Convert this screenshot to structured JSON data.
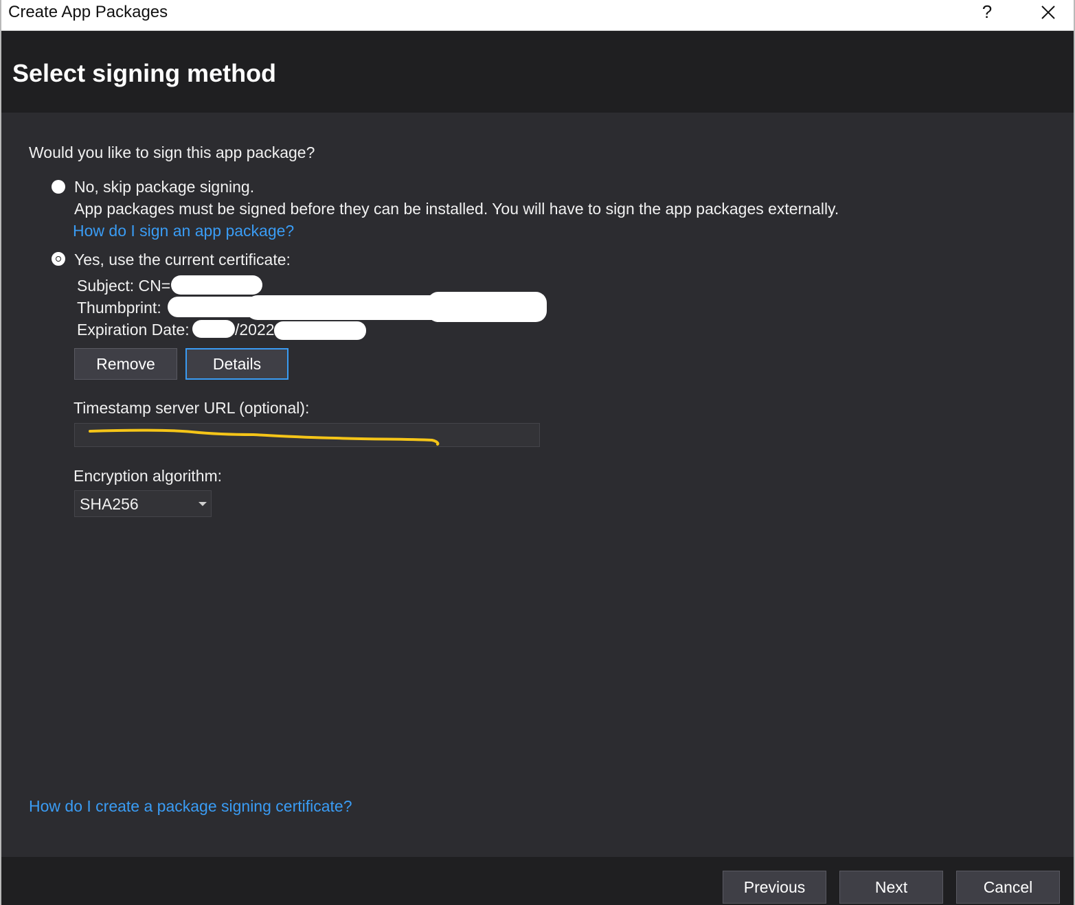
{
  "window": {
    "title": "Create App Packages",
    "help_label": "?"
  },
  "header": {
    "title": "Select signing method"
  },
  "form": {
    "question": "Would you like to sign this app package?",
    "option_no": {
      "label": "No, skip package signing.",
      "description": "App packages must be signed before they can be installed. You will have to sign the app packages externally.",
      "help_link": "How do I sign an app package?"
    },
    "option_yes": {
      "label": "Yes, use the current certificate:",
      "subject_label": "Subject: CN=",
      "thumbprint_label": "Thumbprint:",
      "expiration_label": "Expiration Date:",
      "expiration_visible": "/2022"
    },
    "selected_option": "yes",
    "remove_label": "Remove",
    "details_label": "Details",
    "timestamp_label": "Timestamp server URL (optional):",
    "timestamp_value": "",
    "encryption_label": "Encryption algorithm:",
    "encryption_value": "SHA256",
    "certificate_help_link": "How do I create a package signing certificate?"
  },
  "footer": {
    "previous_label": "Previous",
    "next_label": "Next",
    "cancel_label": "Cancel"
  },
  "colors": {
    "background": "#2c2c30",
    "header": "#1f1f21",
    "link": "#3a9cf4",
    "button": "#3f3f46",
    "annotation": "#f5c518"
  }
}
